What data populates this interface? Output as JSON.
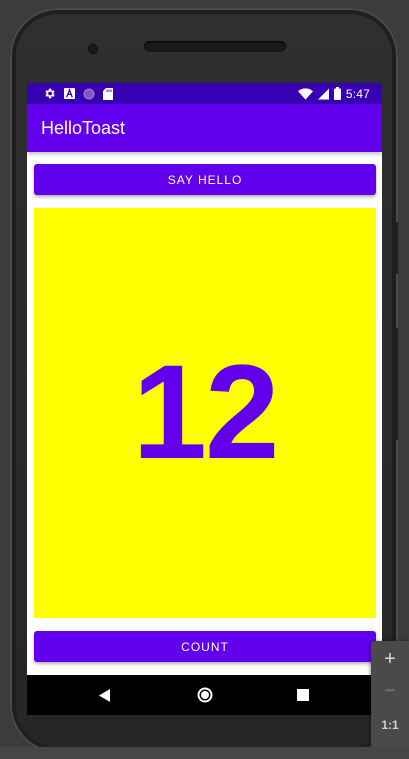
{
  "status_bar": {
    "time": "5:47",
    "left_icons": [
      "settings-icon",
      "accessibility-icon",
      "circle-notification-icon",
      "sd-card-icon"
    ],
    "right_icons": [
      "wifi-icon",
      "cell-signal-icon",
      "battery-icon"
    ]
  },
  "app_bar": {
    "title": "HelloToast"
  },
  "main": {
    "say_hello_label": "SAY HELLO",
    "count_value": "12",
    "count_label": "COUNT"
  },
  "nav_bar": {
    "icons": [
      "back-icon",
      "home-icon",
      "recents-icon"
    ]
  },
  "emulator_controls": {
    "zoom_in": "+",
    "zoom_out": "−",
    "actual_size": "1:1"
  },
  "colors": {
    "primary": "#6200ee",
    "primary_dark": "#3700b3",
    "count_background": "#ffff00",
    "count_text": "#6200ee"
  }
}
